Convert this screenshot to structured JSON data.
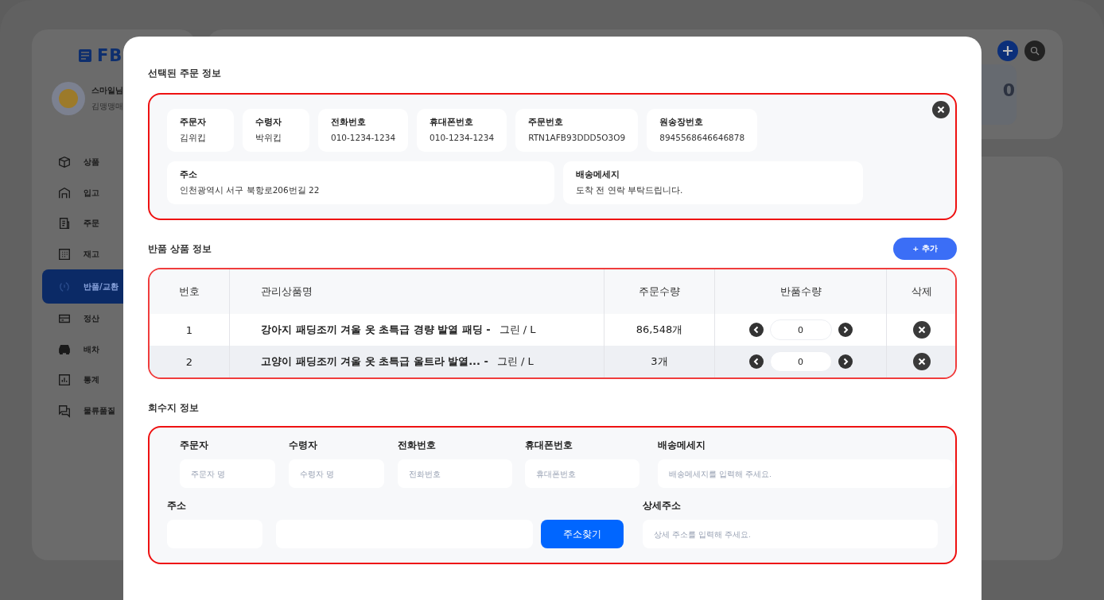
{
  "background": {
    "logo": "FB",
    "profile": {
      "name": "스마일님",
      "subtitle": "김맹맹매"
    },
    "nav": [
      {
        "label": "상품",
        "selected": false
      },
      {
        "label": "입고",
        "selected": false
      },
      {
        "label": "주문",
        "selected": false
      },
      {
        "label": "재고",
        "selected": false
      },
      {
        "label": "반품/교환",
        "selected": true
      },
      {
        "label": "정산",
        "selected": false
      },
      {
        "label": "배차",
        "selected": false
      },
      {
        "label": "통계",
        "selected": false
      },
      {
        "label": "물류품질",
        "selected": false
      }
    ],
    "summary_card": {
      "value": "0"
    }
  },
  "modal": {
    "order_section": {
      "title": "선택된 주문 정보",
      "fields": [
        {
          "label": "주문자",
          "value": "김위킵"
        },
        {
          "label": "수령자",
          "value": "박위킵"
        },
        {
          "label": "전화번호",
          "value": "010-1234-1234"
        },
        {
          "label": "휴대폰번호",
          "value": "010-1234-1234"
        },
        {
          "label": "주문번호",
          "value": "RTN1AFB93DDD5O3O9"
        },
        {
          "label": "원송장번호",
          "value": "8945568646646878"
        }
      ],
      "wide_fields": [
        {
          "label": "주소",
          "value": "인천광역시 서구 북항로206번길 22"
        },
        {
          "label": "배송메세지",
          "value": "도착 전 연락 부탁드립니다."
        }
      ]
    },
    "return_items": {
      "title": "반품 상품 정보",
      "add_button": "+ 추가",
      "columns": [
        "번호",
        "관리상품명",
        "주문수량",
        "반품수량",
        "삭제"
      ],
      "rows": [
        {
          "no": "1",
          "name": "강아지 패딩조끼 겨울 옷 초특급 경량 발열 패딩 -",
          "option": "그린 / L",
          "order_qty": "86,548개",
          "return_qty": "0",
          "selected": false
        },
        {
          "no": "2",
          "name": "고양이 패딩조끼 겨울 옷 초특급 울트라 발열... -",
          "option": "그린 / L",
          "order_qty": "3개",
          "return_qty": "0",
          "selected": true
        }
      ]
    },
    "pickup": {
      "title": "회수지 정보",
      "fields": [
        {
          "label": "주문자",
          "placeholder": "주문자 명"
        },
        {
          "label": "수령자",
          "placeholder": "수령자 명"
        },
        {
          "label": "전화번호",
          "placeholder": "전화번호"
        },
        {
          "label": "휴대폰번호",
          "placeholder": "휴대폰번호"
        },
        {
          "label": "배송메세지",
          "placeholder": "배송메세지를 입력해 주세요."
        }
      ],
      "address_label": "주소",
      "search_button": "주소찾기",
      "detail_label": "상세주소",
      "detail_placeholder": "상세 주소를 입력해 주세요."
    }
  }
}
